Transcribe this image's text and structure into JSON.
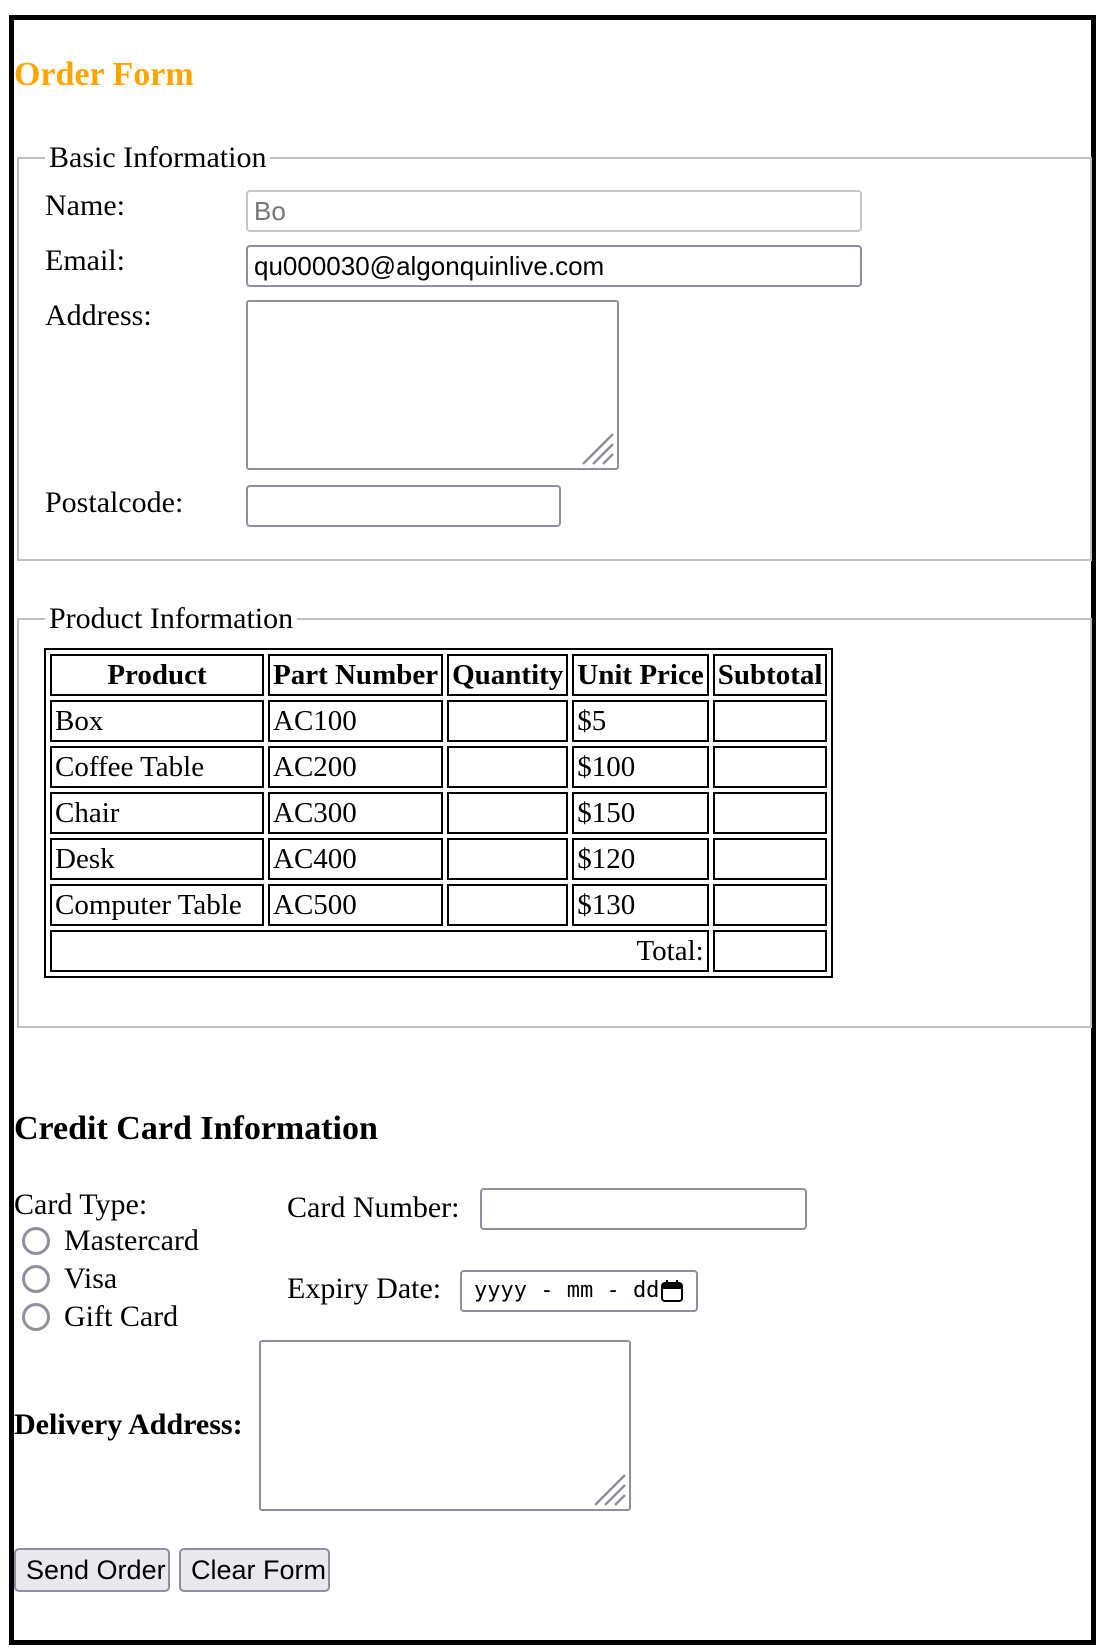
{
  "page": {
    "title": "Order Form"
  },
  "basic": {
    "legend": "Basic Information",
    "name_label": "Name:",
    "name_value": "Bo",
    "email_label": "Email:",
    "email_value": "qu000030@algonquinlive.com",
    "address_label": "Address:",
    "postal_label": "Postalcode:"
  },
  "product": {
    "legend": "Product Information",
    "headers": [
      "Product",
      "Part Number",
      "Quantity",
      "Unit Price",
      "Subtotal"
    ],
    "rows": [
      {
        "product": "Box",
        "part": "AC100",
        "price": "$5"
      },
      {
        "product": "Coffee Table",
        "part": "AC200",
        "price": "$100"
      },
      {
        "product": "Chair",
        "part": "AC300",
        "price": "$150"
      },
      {
        "product": "Desk",
        "part": "AC400",
        "price": "$120"
      },
      {
        "product": "Computer Table",
        "part": "AC500",
        "price": "$130"
      }
    ],
    "total_label": "Total:"
  },
  "credit": {
    "heading": "Credit Card Information",
    "card_type_label": "Card Type:",
    "options": [
      "Mastercard",
      "Visa",
      "Gift Card"
    ],
    "card_number_label": "Card Number:",
    "expiry_label": "Expiry Date:",
    "expiry_placeholder": "yyyy - mm - dd",
    "delivery_label": "Delivery Address:"
  },
  "buttons": {
    "send": "Send Order",
    "clear": "Clear Form"
  },
  "icons": {
    "calendar": "calendar-icon",
    "resize": "resize-grip-icon"
  }
}
